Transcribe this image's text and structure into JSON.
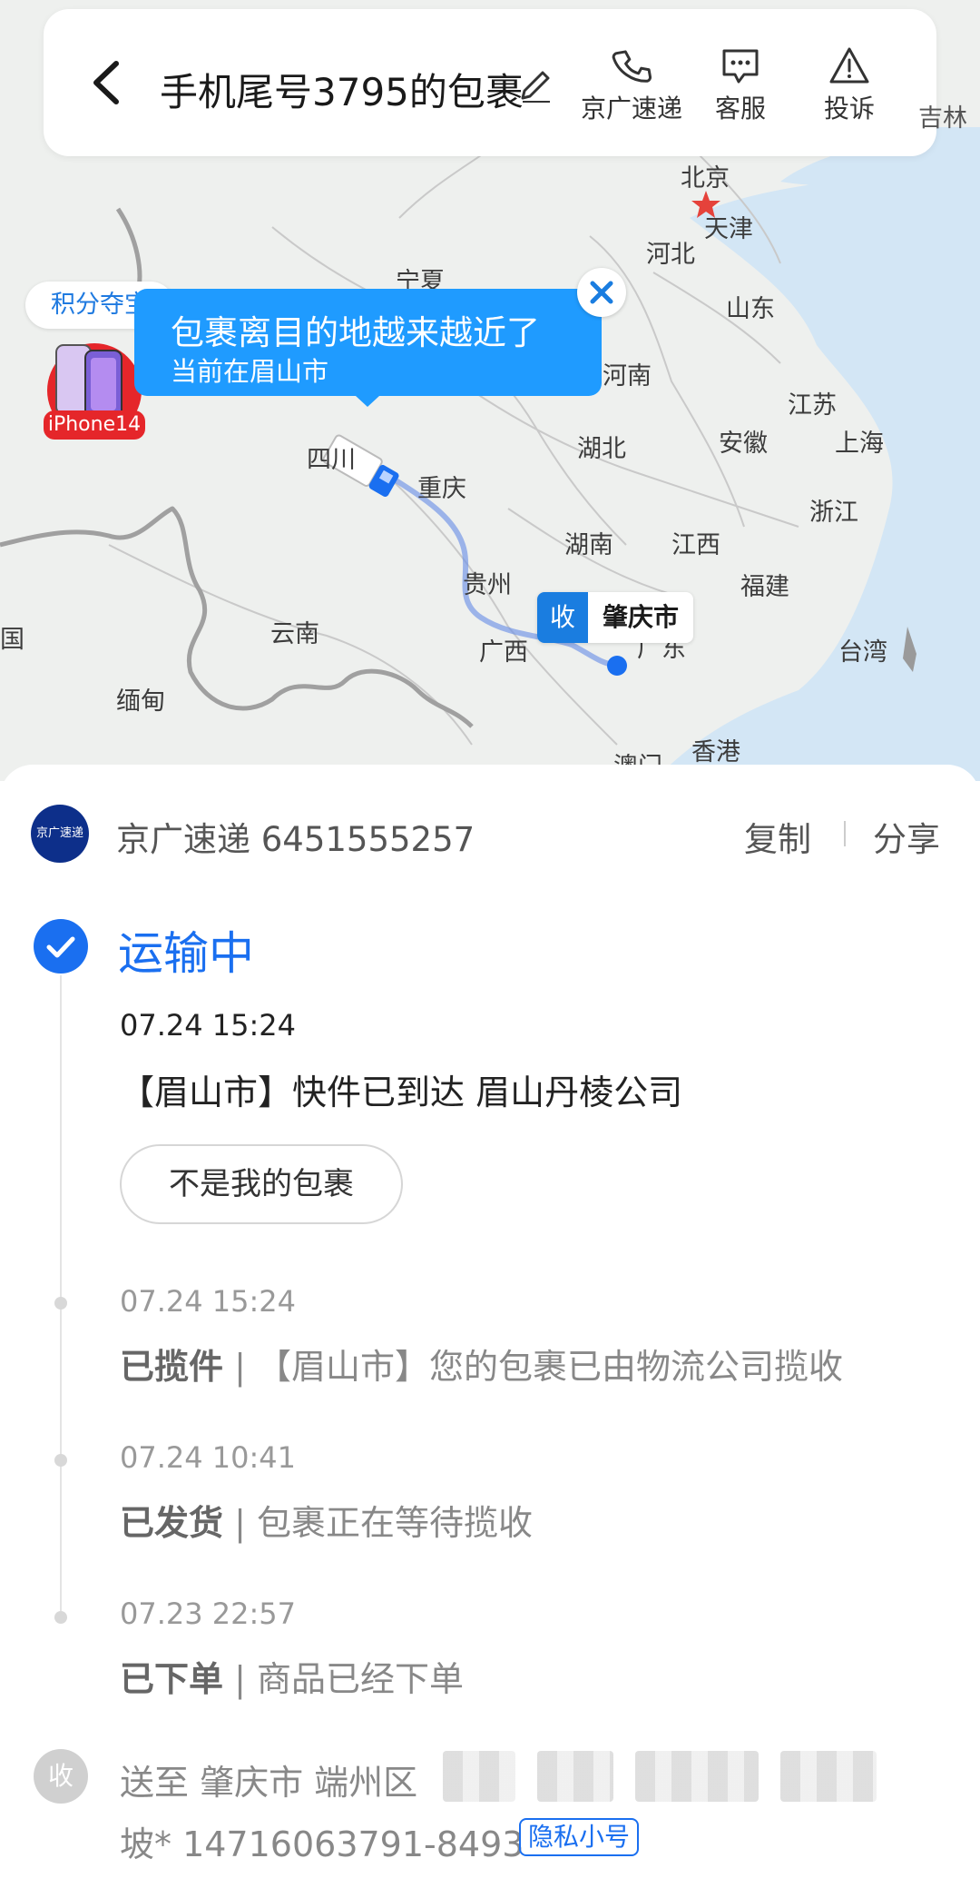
{
  "header": {
    "title": "手机尾号3795的包裹",
    "actions": [
      {
        "label": "京广速递",
        "icon": "phone-icon"
      },
      {
        "label": "客服",
        "icon": "chat-icon"
      },
      {
        "label": "投诉",
        "icon": "warning-icon"
      }
    ],
    "cutoff_text": "吉林"
  },
  "map": {
    "places": [
      "北京",
      "天津",
      "河北",
      "宁夏",
      "山东",
      "河南",
      "江苏",
      "湖北",
      "安徽",
      "上海",
      "四川",
      "重庆",
      "浙江",
      "湖南",
      "江西",
      "贵州",
      "福建",
      "云南",
      "广西",
      "广东",
      "台湾",
      "缅甸",
      "香港",
      "澳门",
      "国"
    ],
    "bubble": {
      "title": "包裹离目的地越来越近了",
      "subtitle": "当前在眉山市"
    },
    "points_chip": "积分夺宝",
    "promo_label": "iPhone14",
    "destination": {
      "tag": "收",
      "city": "肇庆市"
    },
    "colors": {
      "route": "#6f92e6",
      "bubble": "#1f9bff",
      "water": "#d3e6f5"
    }
  },
  "carrier": {
    "logo_text": "京广速递",
    "text": "京广速递 6451555257",
    "copy_label": "复制",
    "share_label": "分享"
  },
  "status": {
    "title": "运输中"
  },
  "latest_event": {
    "time": "07.24 15:24",
    "text": "【眉山市】快件已到达 眉山丹棱公司",
    "not_mine_label": "不是我的包裹"
  },
  "history": [
    {
      "time": "07.24 15:24",
      "status": "已揽件",
      "sep": "|",
      "text": "【眉山市】您的包裹已由物流公司揽收"
    },
    {
      "time": "07.24 10:41",
      "status": "已发货",
      "sep": "|",
      "text": "包裹正在等待揽收"
    },
    {
      "time": "07.23 22:57",
      "status": "已下单",
      "sep": "|",
      "text": "商品已经下单"
    }
  ],
  "receiver": {
    "circle_label": "收",
    "address": "送至 肇庆市 端州区",
    "phone": "坡* 14716063791-8493",
    "privacy_tag": "隐私小号"
  }
}
